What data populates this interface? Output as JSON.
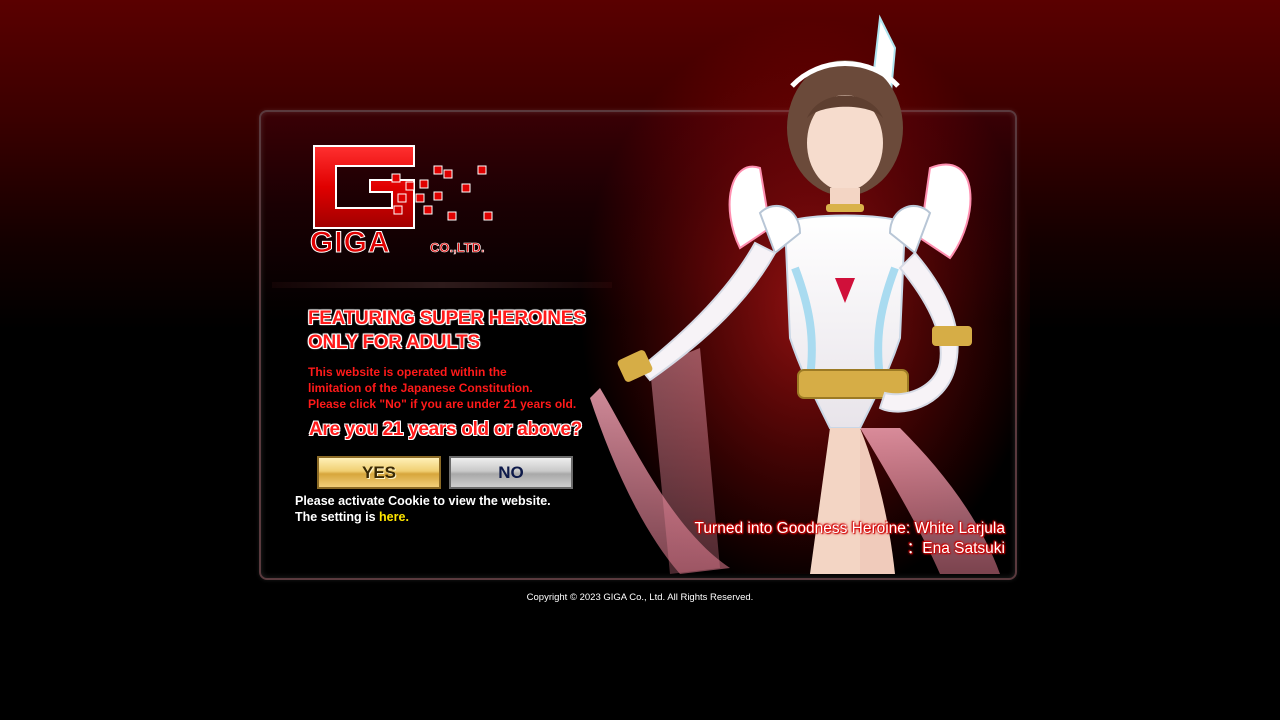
{
  "logo": {
    "letter": "G",
    "name": "GIGA",
    "suffix": "CO.,LTD."
  },
  "headline": {
    "line1": "FEATURING SUPER HEROINES",
    "line2": "ONLY FOR ADULTS"
  },
  "notice": {
    "line1": "This website is operated within the",
    "line2": "limitation of the Japanese Constitution.",
    "line3": "Please click \"No\" if you are under 21 years old."
  },
  "question": "Are you 21 years old or above?",
  "buttons": {
    "yes": "YES",
    "no": "NO"
  },
  "cookie": {
    "line1": "Please activate Cookie to view the website.",
    "line2_prefix": "The setting is ",
    "link": "here."
  },
  "caption": {
    "title": "Turned into Goodness Heroine: White Larjula",
    "performer": "：Ena Satsuki"
  },
  "copyright": "Copyright © 2023 GIGA Co., Ltd. All Rights Reserved.",
  "colors": {
    "accent_red": "#ff1a1a",
    "link_yellow": "#ffe600",
    "background_top": "#5a0000"
  }
}
